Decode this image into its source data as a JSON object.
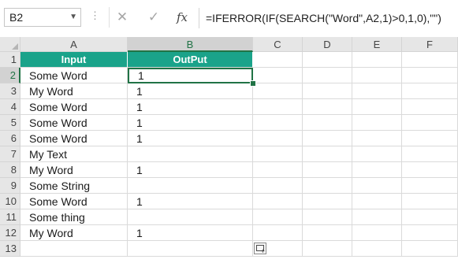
{
  "formula_bar": {
    "name_box": "B2",
    "name_box_dropdown_icon": "chevron-down-icon",
    "cancel_icon": "✕",
    "enter_icon": "✓",
    "fx_label": "fx",
    "formula": "=IFERROR(IF(SEARCH(\"Word\",A2,1)>0,1,0),\"\")"
  },
  "columns": [
    "A",
    "B",
    "C",
    "D",
    "E",
    "F"
  ],
  "selected_column": "B",
  "selected_row": "2",
  "rows": [
    {
      "num": "1",
      "a": "Input",
      "b": "OutPut"
    },
    {
      "num": "2",
      "a": "Some Word",
      "b": "1"
    },
    {
      "num": "3",
      "a": "My Word",
      "b": "1"
    },
    {
      "num": "4",
      "a": "Some Word",
      "b": "1"
    },
    {
      "num": "5",
      "a": "Some Word",
      "b": "1"
    },
    {
      "num": "6",
      "a": "Some Word",
      "b": "1"
    },
    {
      "num": "7",
      "a": "My Text",
      "b": ""
    },
    {
      "num": "8",
      "a": "My Word",
      "b": "1"
    },
    {
      "num": "9",
      "a": "Some String",
      "b": ""
    },
    {
      "num": "10",
      "a": "Some Word",
      "b": "1"
    },
    {
      "num": "11",
      "a": "Some thing",
      "b": ""
    },
    {
      "num": "12",
      "a": "My Word",
      "b": "1"
    },
    {
      "num": "13",
      "a": "",
      "b": ""
    }
  ],
  "colors": {
    "header_fill": "#1aa38a",
    "selection": "#217346"
  }
}
